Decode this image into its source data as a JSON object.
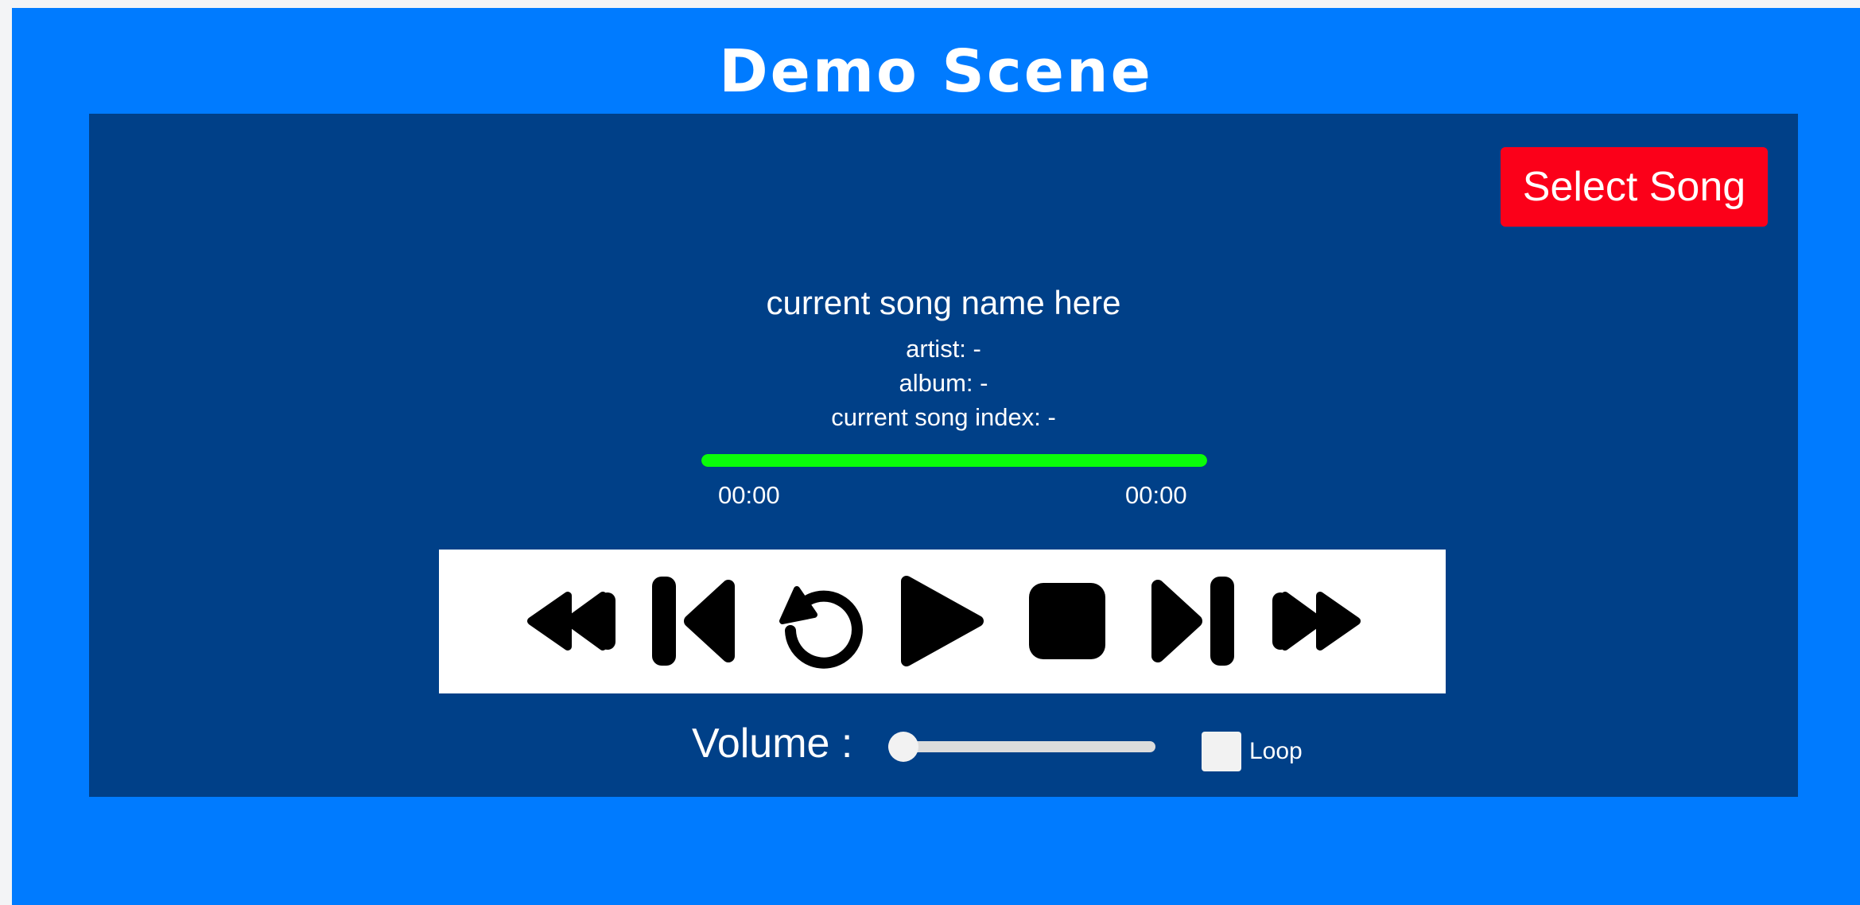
{
  "header": {
    "title": "Demo Scene"
  },
  "player": {
    "select_song_label": "Select Song",
    "song_name": "current song name here",
    "artist": "artist: -",
    "album": "album: -",
    "index": "current song index: -",
    "progress": 1.0,
    "current_time": "00:00",
    "total_time": "00:00",
    "controls": [
      {
        "name": "rewind-icon"
      },
      {
        "name": "previous-track-icon"
      },
      {
        "name": "restart-icon"
      },
      {
        "name": "play-icon"
      },
      {
        "name": "stop-icon"
      },
      {
        "name": "next-track-icon"
      },
      {
        "name": "fast-forward-icon"
      }
    ],
    "volume_label": "Volume :",
    "volume": 0.0,
    "loop_label": "Loop",
    "loop_checked": false
  },
  "colors": {
    "page_background": "#007bff",
    "panel_background": "#004088",
    "select_button": "#fb0019",
    "progress_fill": "#0afc0a",
    "controls_background": "#ffffff",
    "icon_color": "#000000"
  }
}
